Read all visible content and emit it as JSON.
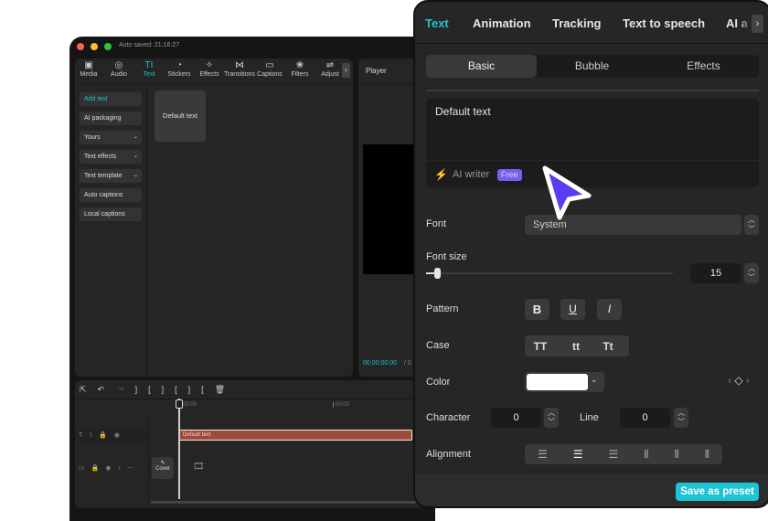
{
  "app": {
    "autosave": "Auto saved: 21:16:27"
  },
  "toolbar": {
    "items": [
      {
        "label": "Media",
        "icon": "▣"
      },
      {
        "label": "Audio",
        "icon": "◎"
      },
      {
        "label": "Text",
        "icon": "TI",
        "active": true
      },
      {
        "label": "Stickers",
        "icon": "◔"
      },
      {
        "label": "Effects",
        "icon": "✧"
      },
      {
        "label": "Transitions",
        "icon": "⋈"
      },
      {
        "label": "Captions",
        "icon": "▭"
      },
      {
        "label": "Filters",
        "icon": "❀"
      },
      {
        "label": "Adjust",
        "icon": "⇌"
      }
    ]
  },
  "sidebar": {
    "items": [
      {
        "label": "Add text",
        "active": true
      },
      {
        "label": "AI packaging"
      },
      {
        "label": "Yours",
        "chevron": "⌄"
      },
      {
        "label": "Text effects",
        "chevron": "⌄"
      },
      {
        "label": "Text template",
        "chevron": "⌄"
      },
      {
        "label": "Auto captions"
      },
      {
        "label": "Local captions"
      }
    ]
  },
  "library": {
    "card": "Default text"
  },
  "player": {
    "title": "Player",
    "time": "00:00:00:00",
    "sep": "/ 0"
  },
  "timeline": {
    "ruler": [
      "00:00",
      "00:02"
    ],
    "clip": "Default text",
    "cover": "Cover"
  },
  "panel": {
    "tabs": [
      "Text",
      "Animation",
      "Tracking",
      "Text to speech",
      "AI a"
    ],
    "subtabs": [
      "Basic",
      "Bubble",
      "Effects"
    ],
    "text_value": "Default text",
    "ai_writer": "AI writer",
    "free_badge": "Free",
    "font_label": "Font",
    "font_value": "System",
    "font_size_label": "Font size",
    "font_size": "15",
    "font_size_slider_fraction": 0.03,
    "pattern_label": "Pattern",
    "pattern": [
      "B",
      "U",
      "I"
    ],
    "case_label": "Case",
    "case": [
      "TT",
      "tt",
      "Tt"
    ],
    "color_label": "Color",
    "color_value": "#ffffff",
    "character_label": "Character",
    "character": "0",
    "line_label": "Line",
    "line": "0",
    "alignment_label": "Alignment",
    "save_preset": "Save as preset"
  },
  "colors": {
    "accent": "#1ec4d4",
    "clip": "#a04a3c",
    "badge": "#7b5cf0",
    "cursor": "#5b3cf2"
  }
}
